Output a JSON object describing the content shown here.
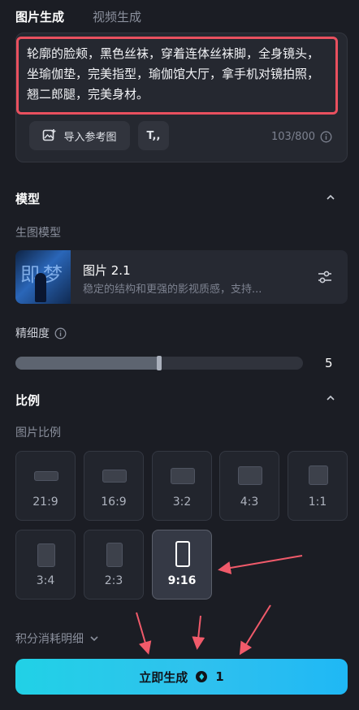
{
  "tabs": [
    {
      "label": "图片生成",
      "active": true
    },
    {
      "label": "视频生成",
      "active": false
    }
  ],
  "prompt": {
    "text": "轮廓的脸颊，黑色丝袜，穿着连体丝袜脚，全身镜头，坐瑜伽垫，完美指型，瑜伽馆大厅，拿手机对镜拍照，翘二郎腿，完美身材。",
    "reference_button": "导入参考图",
    "text_button": "T,,",
    "counter": "103/800"
  },
  "model_section": {
    "title": "模型",
    "sub_label": "生图模型",
    "model": {
      "thumbnail_text": "即梦",
      "name": "图片 2.1",
      "description": "稳定的结构和更强的影视质感，支持..."
    },
    "detail_label": "精细度",
    "detail_value": "5",
    "detail_level_fraction": 0.5
  },
  "ratio_section": {
    "title": "比例",
    "sub_label": "图片比例",
    "options": [
      {
        "label": "21:9",
        "selected": false
      },
      {
        "label": "16:9",
        "selected": false
      },
      {
        "label": "3:2",
        "selected": false
      },
      {
        "label": "4:3",
        "selected": false
      },
      {
        "label": "1:1",
        "selected": false
      },
      {
        "label": "3:4",
        "selected": false
      },
      {
        "label": "2:3",
        "selected": false
      },
      {
        "label": "9:16",
        "selected": true
      }
    ]
  },
  "footer": {
    "credits_label": "积分消耗明细",
    "generate_label": "立即生成",
    "generate_cost": "1"
  },
  "colors": {
    "accent": "#21d1e6",
    "highlight_border": "#e9505f",
    "background": "#1b1d24"
  }
}
